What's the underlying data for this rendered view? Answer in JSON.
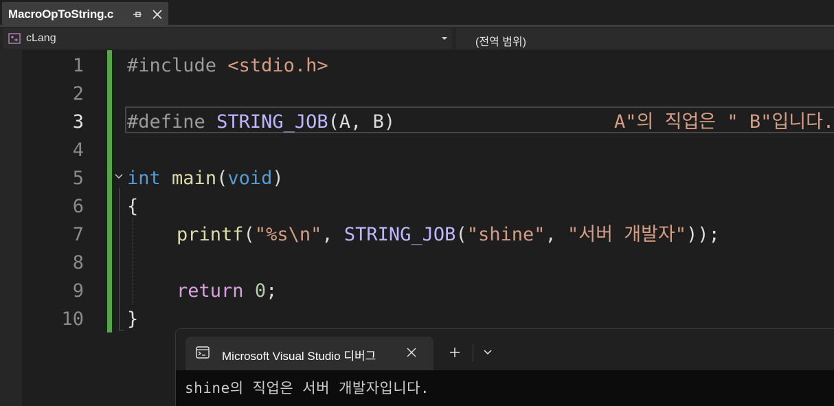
{
  "tab": {
    "filename": "MacroOpToString.c"
  },
  "navbar": {
    "scope": "cLang",
    "member": "(전역 범위)"
  },
  "editor": {
    "line_numbers": [
      "1",
      "2",
      "3",
      "4",
      "5",
      "6",
      "7",
      "8",
      "9",
      "10"
    ],
    "active_line": 3,
    "lines": {
      "l1": {
        "directive": "#include",
        "header": "<stdio.h>"
      },
      "l3": {
        "directive": "#define",
        "macro": "STRING_JOB",
        "params": "(A, B)",
        "body": "A\"의 직업은 \" B\"입니다.\""
      },
      "l5": {
        "type": "int",
        "fn": "main",
        "open": "(",
        "param": "void",
        "close": ")"
      },
      "l6": {
        "brace": "{"
      },
      "l7": {
        "fn": "printf",
        "p1": "(",
        "fmt": "\"%s\\n\"",
        "comma1": ", ",
        "macro": "STRING_JOB",
        "p2": "(",
        "arg1": "\"shine\"",
        "comma2": ", ",
        "arg2": "\"서버 개발자\"",
        "tail": "));"
      },
      "l9": {
        "kw": "return",
        "num": "0",
        "semi": ";"
      },
      "l10": {
        "brace": "}"
      }
    }
  },
  "console": {
    "title": "Microsoft Visual Studio 디버그",
    "output": "shine의 직업은 서버 개발자입니다."
  },
  "icons": {
    "pin": "pin-icon",
    "close": "close-icon",
    "scope": "project-scope-icon",
    "dropdown": "chevron-down-icon",
    "fold": "collapse-chevron-icon",
    "terminal": "terminal-icon",
    "new_tab": "plus-icon",
    "tab_menu": "chevron-down-icon"
  },
  "colors": {
    "background": "#1e1e1e",
    "change_bar": "#57a64a",
    "keyword": "#569cd6",
    "string": "#d69d85",
    "function": "#dcdcaa",
    "macro": "#beb7ff",
    "control": "#d8a0df",
    "preprocessor": "#9b9b9b",
    "number": "#b5cea8"
  }
}
